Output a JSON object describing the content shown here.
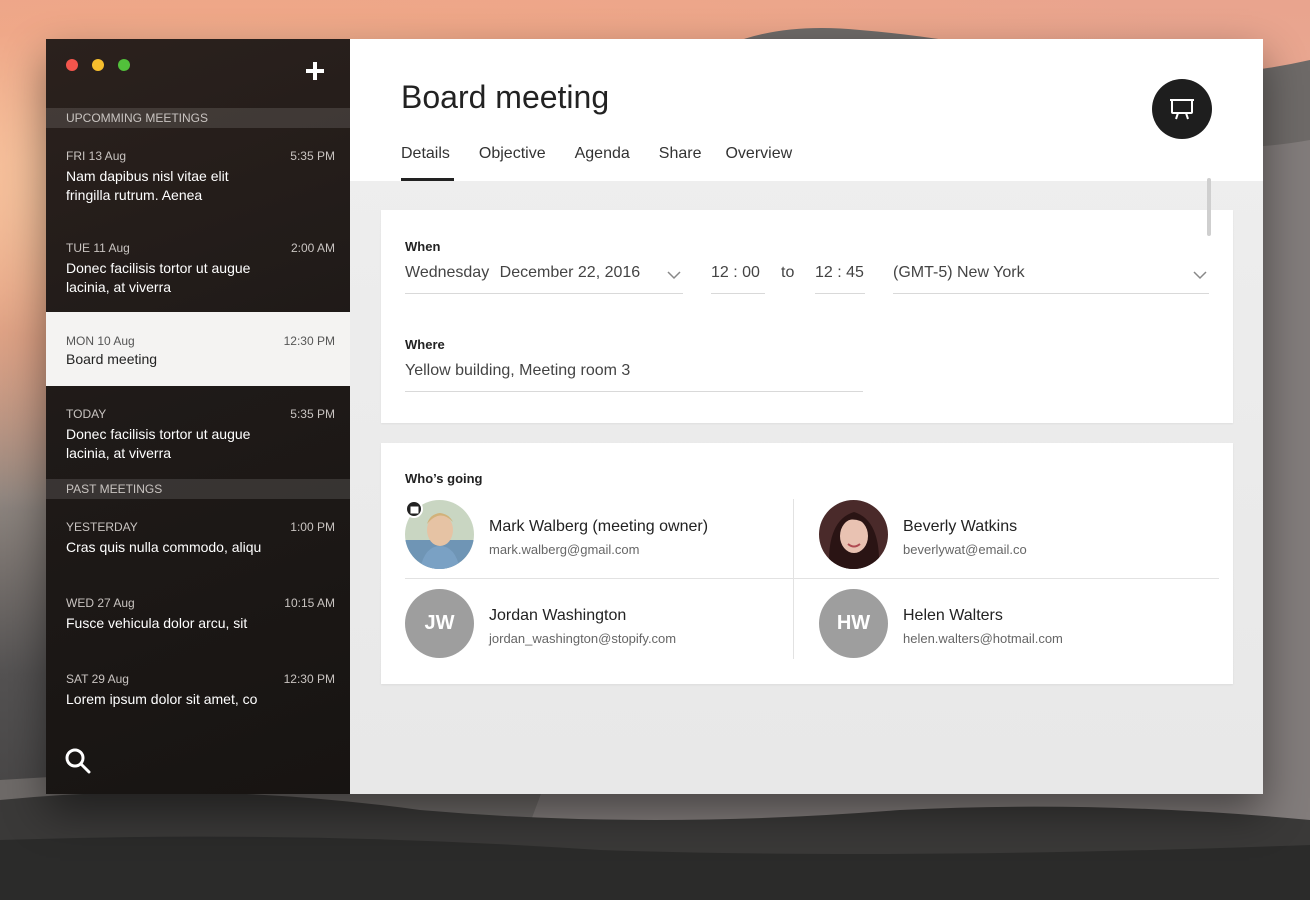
{
  "colors": {
    "sidebar_bg": "#1f1a18",
    "active_item_bg": "#f4f3f2",
    "traffic_red": "#f2554c",
    "traffic_yellow": "#f6be2d",
    "traffic_green": "#52c13b",
    "initials_avatar": "#9e9e9e"
  },
  "sidebar": {
    "add_icon": "plus-icon",
    "search_icon": "search-icon",
    "upcoming_header": "UPCOMMING MEETINGS",
    "past_header": "PAST MEETINGS",
    "upcoming": [
      {
        "date": "FRI 13 Aug",
        "time": "5:35 PM",
        "title": "Nam dapibus nisl vitae elit fringilla rutrum. Aenea"
      },
      {
        "date": "TUE 11 Aug",
        "time": "2:00 AM",
        "title": "Donec facilisis tortor ut augue lacinia, at viverra"
      },
      {
        "date": "MON 10 Aug",
        "time": "12:30 PM",
        "title": "Board meeting"
      },
      {
        "date": "TODAY",
        "time": "5:35 PM",
        "title": "Donec facilisis tortor ut augue lacinia, at viverra"
      }
    ],
    "past": [
      {
        "date": "YESTERDAY",
        "time": "1:00 PM",
        "title": "Cras quis nulla commodo, aliqu"
      },
      {
        "date": "WED 27 Aug",
        "time": "10:15 AM",
        "title": "Fusce vehicula dolor arcu, sit"
      },
      {
        "date": "SAT 29 Aug",
        "time": "12:30 PM",
        "title": "Lorem ipsum dolor sit amet, co"
      }
    ]
  },
  "header": {
    "title": "Board meeting",
    "present_icon": "presentation-icon",
    "tabs": [
      "Details",
      "Objective",
      "Agenda",
      "Share",
      "Overview"
    ],
    "active_tab": "Details"
  },
  "when": {
    "label": "When",
    "day": "Wednesday",
    "date": "December 22, 2016",
    "start": "12 : 00",
    "to": "to",
    "end": "12 : 45",
    "timezone": "(GMT-5) New York"
  },
  "where": {
    "label": "Where",
    "value": "Yellow building, Meeting room 3"
  },
  "attendees": {
    "label": "Who’s going",
    "people": [
      {
        "name": "Mark Walberg (meeting owner)",
        "email": "mark.walberg@gmail.com",
        "initials": ""
      },
      {
        "name": "Beverly Watkins",
        "email": "beverlywat@email.co",
        "initials": ""
      },
      {
        "name": "Jordan Washington",
        "email": "jordan_washington@stopify.com",
        "initials": "JW"
      },
      {
        "name": "Helen Walters",
        "email": "helen.walters@hotmail.com",
        "initials": "HW"
      }
    ]
  }
}
